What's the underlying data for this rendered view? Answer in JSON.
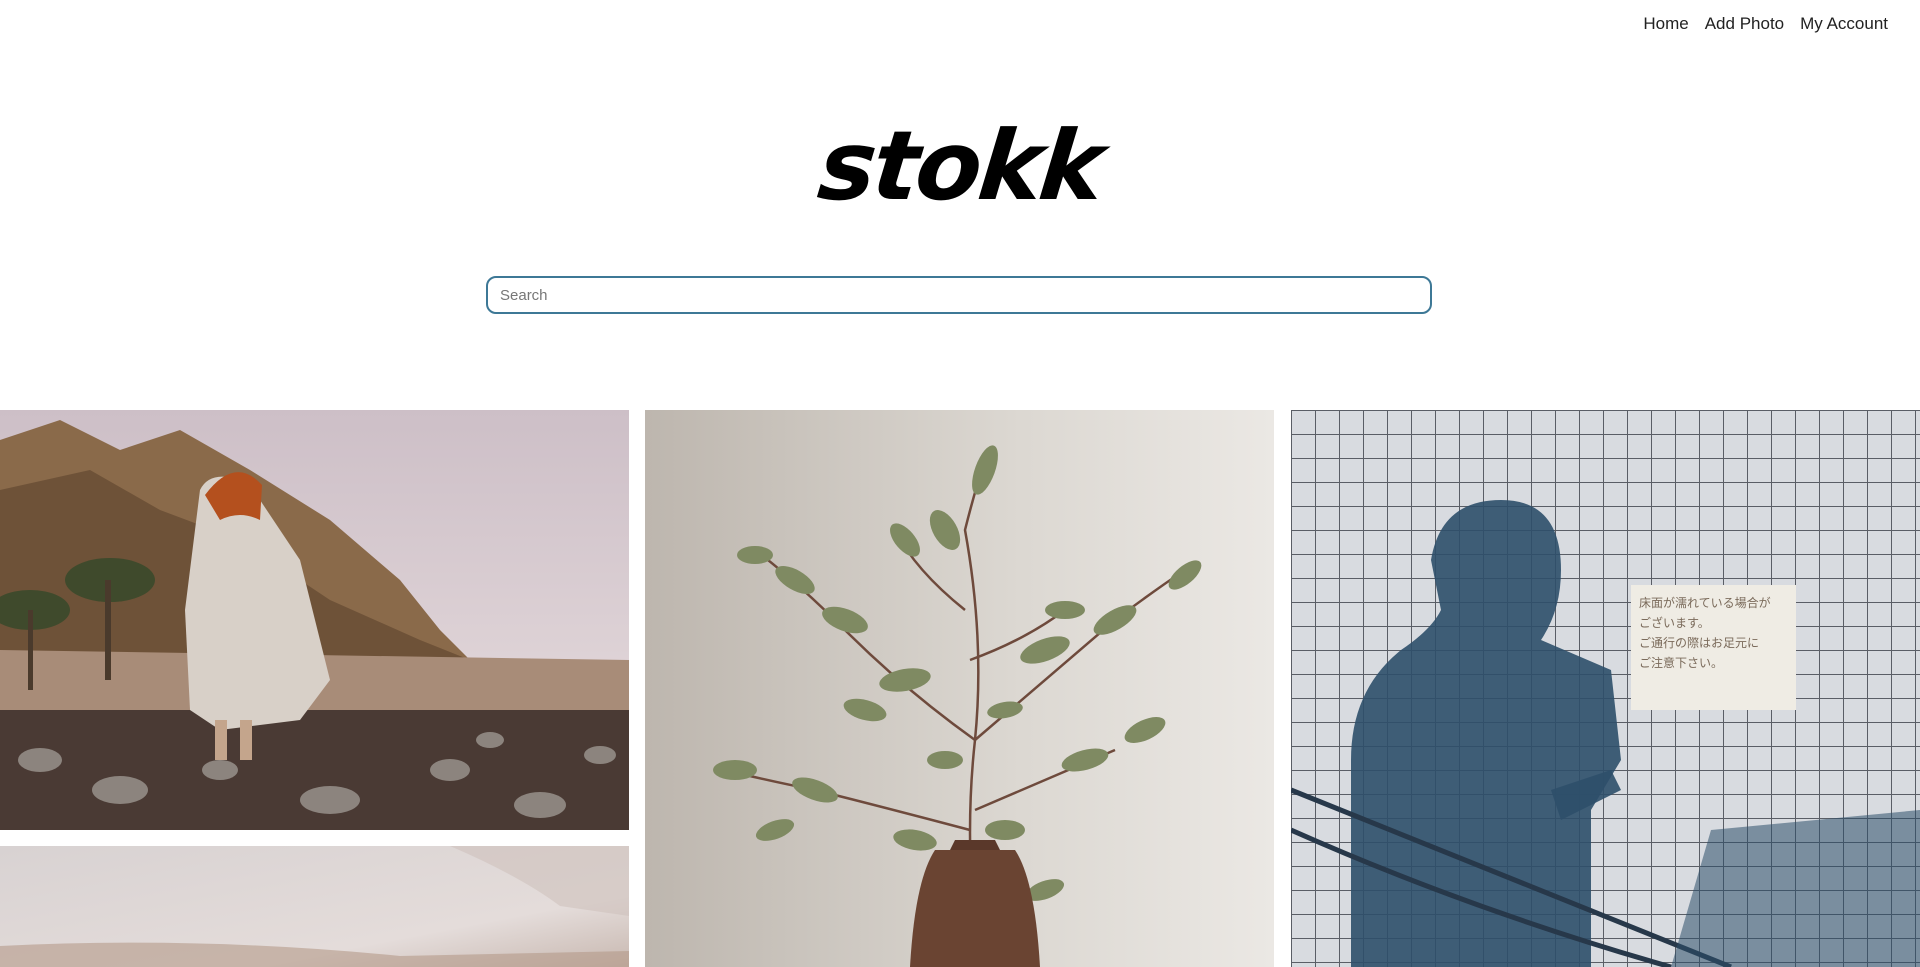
{
  "nav": {
    "home": "Home",
    "add_photo": "Add Photo",
    "my_account": "My Account"
  },
  "brand": {
    "logo": "stokk"
  },
  "search": {
    "placeholder": "Search",
    "value": ""
  },
  "photos": [
    {
      "subject": "woman on rocky beach"
    },
    {
      "subject": "eucalyptus branch in vase"
    },
    {
      "subject": "shadow on tiled wall"
    },
    {
      "subject": "misty landscape"
    }
  ],
  "sign": {
    "line1": "床面が濡れている場合が",
    "line2": "ございます。",
    "line3": "ご通行の際はお足元に",
    "line4": "ご注意下さい。"
  }
}
